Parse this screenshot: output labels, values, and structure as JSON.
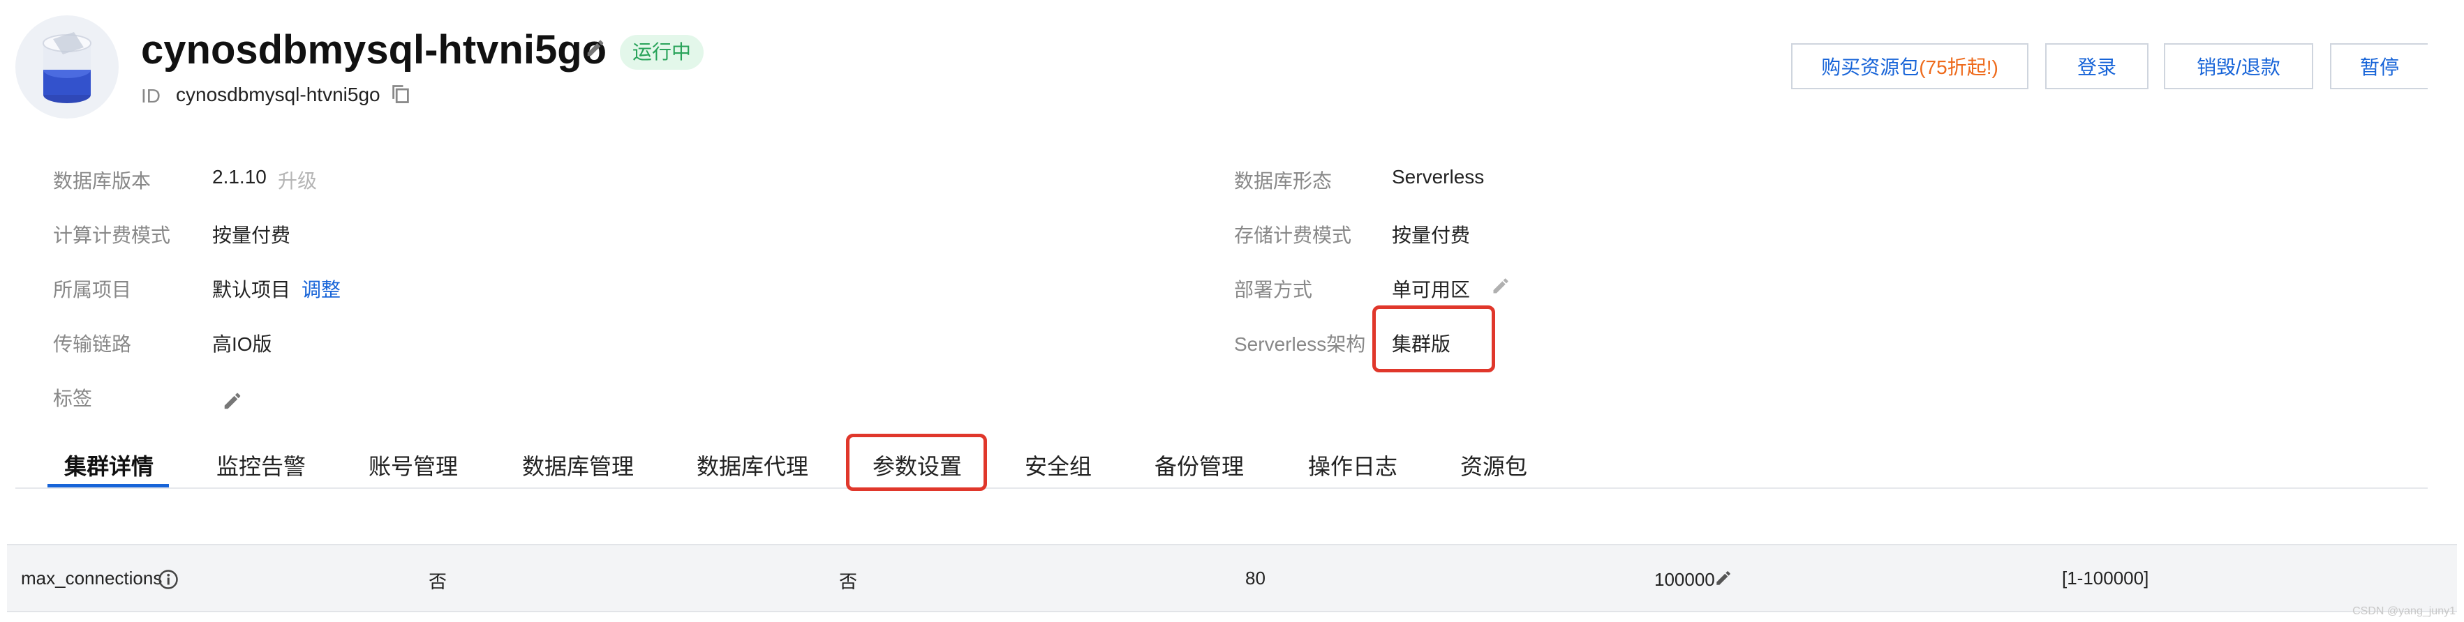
{
  "header": {
    "instance_name": "cynosdbmysql-htvni5go",
    "status": "运行中",
    "id_label": "ID",
    "id_value": "cynosdbmysql-htvni5go",
    "buttons": {
      "buy_prefix": "购买资源包",
      "buy_promo": "(75折起!)",
      "login": "登录",
      "destroy": "销毁/退款",
      "pause": "暂停"
    }
  },
  "info": {
    "left": [
      {
        "label": "数据库版本",
        "value": "2.1.10",
        "extra": "升级"
      },
      {
        "label": "计算计费模式",
        "value": "按量付费"
      },
      {
        "label": "所属项目",
        "value": "默认项目",
        "link": "调整"
      },
      {
        "label": "传输链路",
        "value": "高IO版"
      },
      {
        "label": "标签"
      }
    ],
    "right": [
      {
        "label": "数据库形态",
        "value": "Serverless"
      },
      {
        "label": "存储计费模式",
        "value": "按量付费"
      },
      {
        "label": "部署方式",
        "value": "单可用区"
      },
      {
        "label": "Serverless架构",
        "value": "集群版"
      }
    ]
  },
  "tabs": [
    "集群详情",
    "监控告警",
    "账号管理",
    "数据库管理",
    "数据库代理",
    "参数设置",
    "安全组",
    "备份管理",
    "操作日志",
    "资源包"
  ],
  "param_row": {
    "name": "max_connections",
    "col2": "否",
    "col3": "否",
    "col4": "80",
    "current": "100000",
    "range": "[1-100000]"
  },
  "watermark": "CSDN @yang_juny1",
  "colors": {
    "accent": "#1764d8",
    "highlight": "#e0372b",
    "status_green": "#29a35a",
    "promo": "#ee6a1b"
  },
  "icons": [
    "database-logo-icon",
    "pencil-icon",
    "copy-icon",
    "info-icon"
  ]
}
